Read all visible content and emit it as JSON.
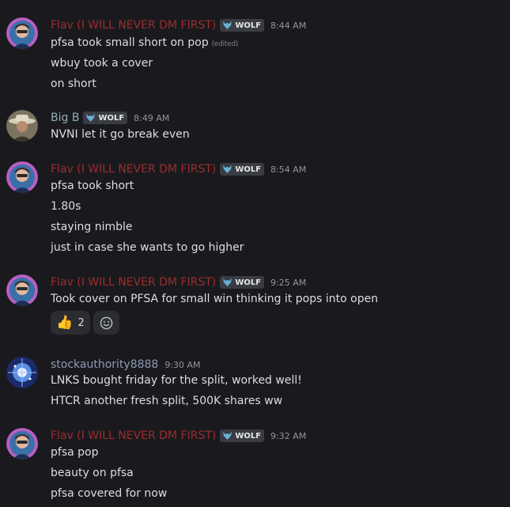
{
  "colors": {
    "background": "#1a1a1e",
    "flav_name": "#9a2d2d",
    "bigb_name": "#8eb0b8",
    "stock_name": "#8e9bb5",
    "message_text": "#dbdee1",
    "timestamp": "#94959c",
    "tag_bg": "#3a3c43"
  },
  "tag_label": "WOLF",
  "messages": [
    {
      "author": "Flav (I WILL NEVER DM FIRST)",
      "time": "8:44 AM",
      "lines": [
        "pfsa took small short on pop",
        "wbuy took a cover",
        "on short"
      ],
      "edited": "(edited)"
    },
    {
      "author": "Big B",
      "time": "8:49 AM",
      "lines": [
        "NVNI let it go break even"
      ]
    },
    {
      "author": "Flav (I WILL NEVER DM FIRST)",
      "time": "8:54 AM",
      "lines": [
        "pfsa took short",
        "1.80s",
        "staying nimble",
        "just in case she wants to go higher"
      ]
    },
    {
      "author": "Flav (I WILL NEVER DM FIRST)",
      "time": "9:25 AM",
      "lines": [
        "Took cover on PFSA for small win thinking it pops into open"
      ],
      "reactions": [
        {
          "emoji": "👍",
          "count": "2",
          "icon": "thumbs-up-icon"
        }
      ],
      "add_reaction_icon": "add-reaction-icon"
    },
    {
      "author": "stockauthority8888",
      "time": "9:30 AM",
      "lines": [
        "LNKS bought friday for the split, worked well!",
        "HTCR another fresh split, 500K shares ww"
      ]
    },
    {
      "author": "Flav (I WILL NEVER DM FIRST)",
      "time": "9:32 AM",
      "lines": [
        "pfsa pop",
        "beauty on pfsa",
        "pfsa covered for now"
      ]
    }
  ]
}
